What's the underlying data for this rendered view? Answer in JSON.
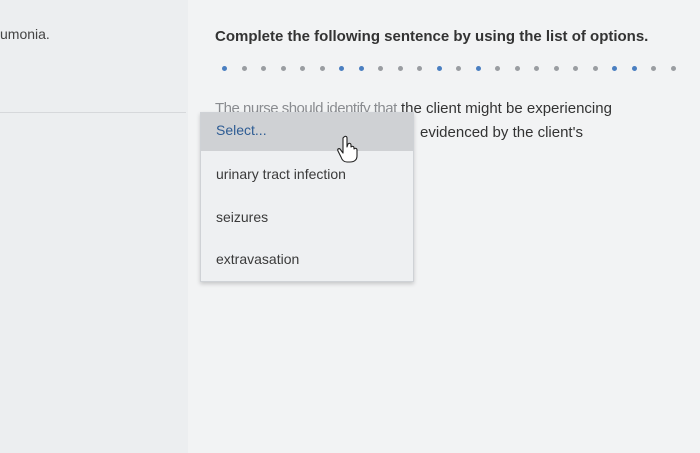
{
  "side": {
    "partial_text": "umonia."
  },
  "question": {
    "title": "Complete the following sentence by using the list of options.",
    "sentence_line1_hidden": "The nurse should identify that",
    "sentence_line1_visible": "the client might be experiencing",
    "sentence_line2_visible": "evidenced by the client's"
  },
  "dropdown": {
    "selected": "Select...",
    "options": [
      "urinary tract infection",
      "seizures",
      "extravasation"
    ]
  },
  "colors": {
    "selected_text": "#2e5c94",
    "dot_blue": "#4a7fc1",
    "dot_gray": "#9a9da1"
  }
}
